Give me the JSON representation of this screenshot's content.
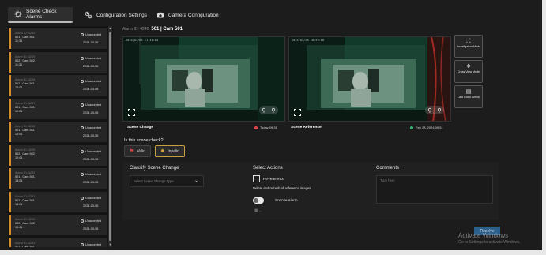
{
  "tabs": [
    {
      "label": "Scene Check Alarms",
      "icon": "scene-check-icon",
      "active": true
    },
    {
      "label": "Configuration Settings",
      "icon": "settings-gears-icon",
      "active": false
    },
    {
      "label": "Camera Configuration",
      "icon": "camera-icon",
      "active": false
    }
  ],
  "alarms": [
    {
      "alarm_id": "Alarm ID: 4240",
      "camera": "501 | Cam 501",
      "time": "11:31",
      "status": "Unaccepted",
      "date": "2024-03-05"
    },
    {
      "alarm_id": "Alarm ID: 4239",
      "camera": "502 | Cam 502",
      "time": "11:31",
      "status": "Unaccepted",
      "date": "2024-03-05"
    },
    {
      "alarm_id": "Alarm ID: 4238",
      "camera": "501 | Cam 501",
      "time": "12:01",
      "status": "Unaccepted",
      "date": "2024-03-05"
    },
    {
      "alarm_id": "Alarm ID: 4237",
      "camera": "501 | Cam 501",
      "time": "12:01",
      "status": "Unaccepted",
      "date": "2024-03-05"
    },
    {
      "alarm_id": "Alarm ID: 4236",
      "camera": "501 | Cam 501",
      "time": "12:01",
      "status": "Unaccepted",
      "date": "2024-03-05"
    },
    {
      "alarm_id": "Alarm ID: 4235",
      "camera": "502 | Cam 502",
      "time": "12:01",
      "status": "Unaccepted",
      "date": "2024-03-05"
    },
    {
      "alarm_id": "Alarm ID: 4234",
      "camera": "501 | Cam 501",
      "time": "13:01",
      "status": "Unaccepted",
      "date": "2024-03-05"
    },
    {
      "alarm_id": "Alarm ID: 4233",
      "camera": "501 | Cam 501",
      "time": "13:01",
      "status": "Unaccepted",
      "date": "2024-03-05"
    },
    {
      "alarm_id": "Alarm ID: 4232",
      "camera": "502 | Cam 502",
      "time": "13:01",
      "status": "Unaccepted",
      "date": "2024-03-05"
    },
    {
      "alarm_id": "Alarm ID: 4231",
      "camera": "501 | Cam 501",
      "time": "",
      "status": "Unaccepted",
      "date": ""
    }
  ],
  "detail": {
    "alarm_label": "Alarm ID: 4240",
    "camera_title": "501 | Cam 501",
    "frames": [
      {
        "caption": "Scene Change",
        "timestamp_overlay": "2024/03/05 11:31:04",
        "date": "Today 09:31",
        "dot_color": "#e04848"
      },
      {
        "caption": "Scene Reference",
        "timestamp_overlay": "2024/02/28 10:59:08",
        "date": "Feb 28, 2024 09:51",
        "dot_color": "#3cb878"
      }
    ]
  },
  "side_buttons": [
    {
      "label": "Investigation Mode",
      "icon": "investigation-icon"
    },
    {
      "label": "Cross View Mode",
      "icon": "cross-view-icon"
    },
    {
      "label": "Last Good Check",
      "icon": "last-good-check-icon"
    }
  ],
  "question": "Is this scene check?",
  "valid_label": "Valid",
  "invalid_label": "Invalid",
  "classify": {
    "title": "Classify Scene Change",
    "placeholder": "Select Scene Change Type"
  },
  "actions": {
    "title": "Select Actions",
    "rereference_label": "Re-reference",
    "rereference_desc": "Delete and refresh all reference images.",
    "snooze_label": "Snooze Alarm"
  },
  "comments": {
    "title": "Comments",
    "placeholder": "Type here"
  },
  "resolve_label": "Resolve",
  "watermark": {
    "title": "Activate Windows",
    "subtitle": "Go to Settings to activate Windows."
  },
  "colors": {
    "accent": "#d98c28",
    "resolve": "#2b5f8c",
    "invalid_border": "#c8a040"
  }
}
